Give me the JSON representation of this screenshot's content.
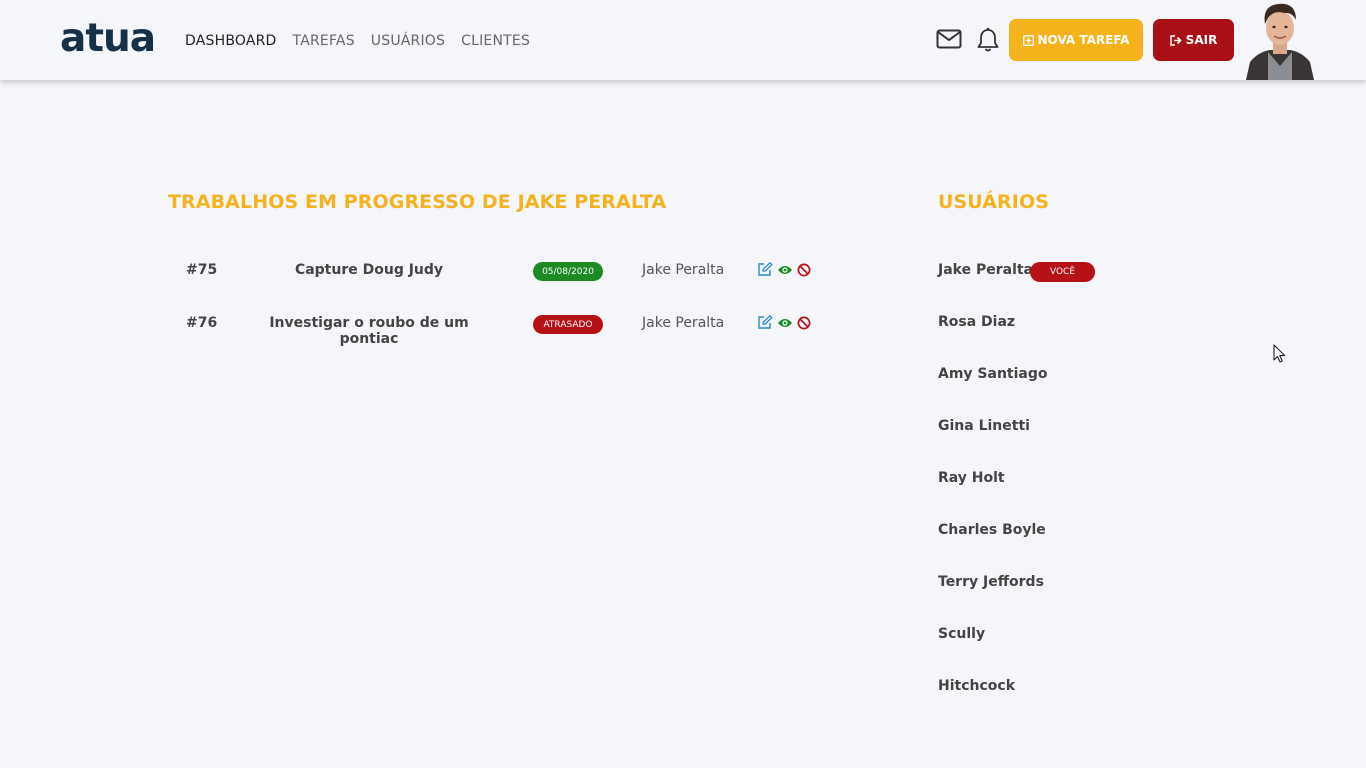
{
  "header": {
    "logo": "atua",
    "nav": [
      "DASHBOARD",
      "TAREFAS",
      "USUÁRIOS",
      "CLIENTES"
    ],
    "active_nav": "DASHBOARD",
    "new_task_label": "NOVA TAREFA",
    "exit_label": "SAIR",
    "colors": {
      "new_task": "#f6b21b",
      "exit": "#a90f16",
      "logo": "#153047"
    },
    "icons": [
      "envelope-icon",
      "bell-icon",
      "plus-square-icon",
      "sign-out-icon"
    ]
  },
  "tasks": {
    "title": "TRABALHOS EM PROGRESSO DE JAKE PERALTA",
    "rows": [
      {
        "id": "#75",
        "name": "Capture Doug Judy",
        "status": "05/08/2020",
        "status_color": "#1d8a24",
        "owner": "Jake Peralta"
      },
      {
        "id": "#76",
        "name": "Investigar o roubo de um pontiac",
        "status": "ATRASADO",
        "status_color": "#b51218",
        "owner": "Jake Peralta"
      }
    ],
    "action_icons": [
      "edit-icon",
      "eye-icon",
      "ban-icon"
    ]
  },
  "users": {
    "title": "USUÁRIOS",
    "you_label": "VOCÊ",
    "items": [
      "Jake Peralta",
      "Rosa Diaz",
      "Amy Santiago",
      "Gina Linetti",
      "Ray Holt",
      "Charles Boyle",
      "Terry Jeffords",
      "Scully",
      "Hitchcock"
    ]
  }
}
